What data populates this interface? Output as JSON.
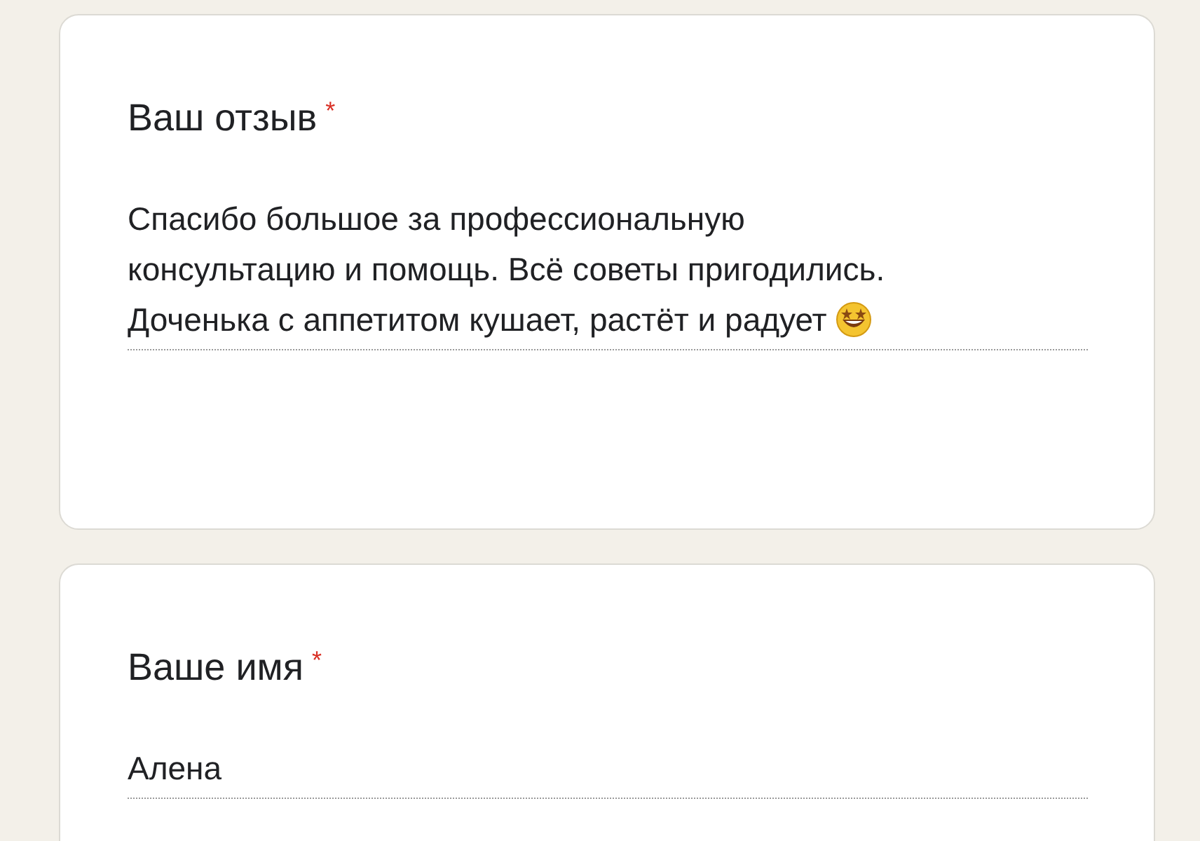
{
  "questions": [
    {
      "title": "Ваш отзыв",
      "required": "*",
      "kind": "paragraph",
      "value": "Спасибо большое за профессиональную консультацию и помощь. Всё советы пригодились. Доченька с аппетитом кушает, растёт и радует",
      "emoji": true
    },
    {
      "title": "Ваше имя",
      "required": "*",
      "kind": "short",
      "value": "Алена",
      "emoji": false
    }
  ]
}
